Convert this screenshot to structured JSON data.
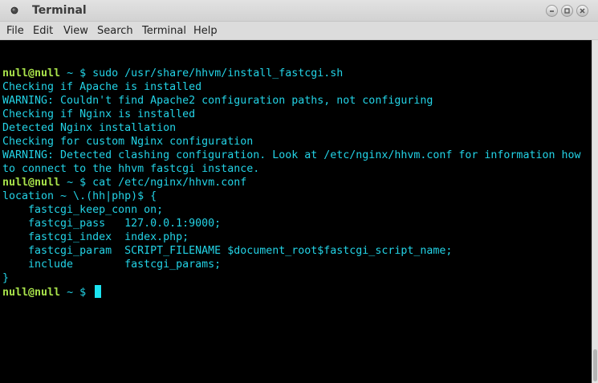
{
  "window": {
    "title": "Terminal"
  },
  "menu": [
    "File",
    "Edit",
    "View",
    "Search",
    "Terminal",
    "Help"
  ],
  "prompt": {
    "user_host": "null@null",
    "path_symbol": " ~ $ "
  },
  "terminal_lines": [
    {
      "type": "prompt",
      "command": "sudo /usr/share/hhvm/install_fastcgi.sh"
    },
    {
      "type": "output",
      "text": "Checking if Apache is installed"
    },
    {
      "type": "output",
      "text": "WARNING: Couldn't find Apache2 configuration paths, not configuring"
    },
    {
      "type": "output",
      "text": "Checking if Nginx is installed"
    },
    {
      "type": "output",
      "text": "Detected Nginx installation"
    },
    {
      "type": "output",
      "text": "Checking for custom Nginx configuration"
    },
    {
      "type": "output",
      "text": "WARNING: Detected clashing configuration. Look at /etc/nginx/hhvm.conf for information how"
    },
    {
      "type": "output",
      "text": "to connect to the hhvm fastcgi instance."
    },
    {
      "type": "prompt",
      "command": "cat /etc/nginx/hhvm.conf"
    },
    {
      "type": "output",
      "text": "location ~ \\.(hh|php)$ {"
    },
    {
      "type": "output",
      "text": "    fastcgi_keep_conn on;"
    },
    {
      "type": "output",
      "text": "    fastcgi_pass   127.0.0.1:9000;"
    },
    {
      "type": "output",
      "text": "    fastcgi_index  index.php;"
    },
    {
      "type": "output",
      "text": "    fastcgi_param  SCRIPT_FILENAME $document_root$fastcgi_script_name;"
    },
    {
      "type": "output",
      "text": "    include        fastcgi_params;"
    },
    {
      "type": "output",
      "text": "}"
    },
    {
      "type": "prompt",
      "command": "",
      "cursor": true
    }
  ],
  "colors": {
    "background": "#000000",
    "output_text": "#23d3e6",
    "prompt": "#a9e34b",
    "cursor": "#1be3f0"
  },
  "icons": {
    "window": "terminal-app-icon",
    "buttons": [
      "minimize-icon",
      "maximize-icon",
      "close-icon"
    ]
  }
}
